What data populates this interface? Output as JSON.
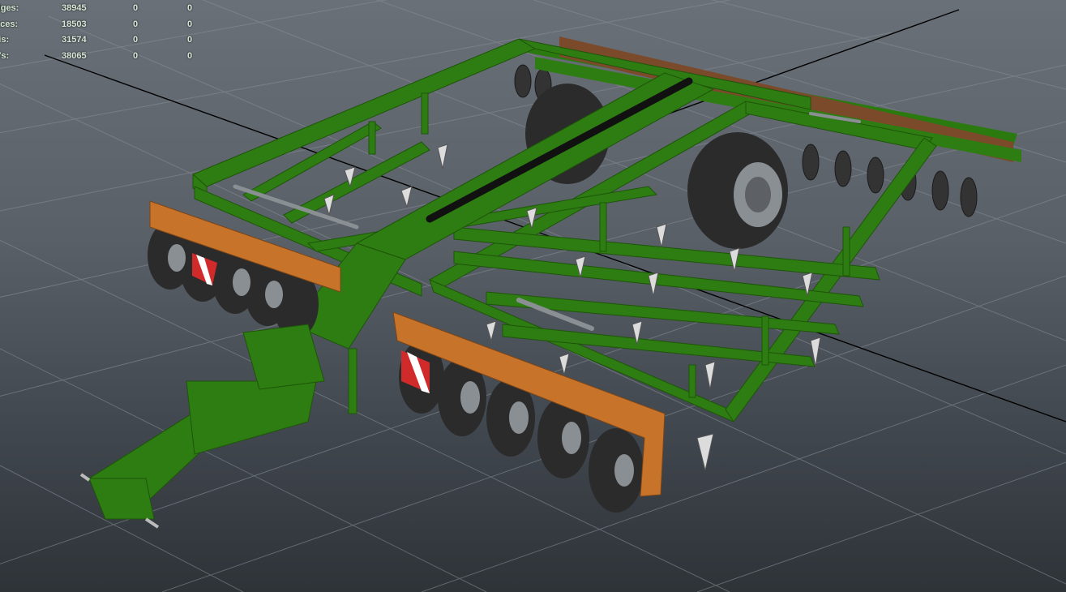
{
  "hud": {
    "rows": [
      {
        "label": "dges:",
        "value": "38945",
        "selected": "0",
        "components": "0"
      },
      {
        "label": "aces:",
        "value": "18503",
        "selected": "0",
        "components": "0"
      },
      {
        "label": "ris:",
        "value": "31574",
        "selected": "0",
        "components": "0"
      },
      {
        "label": "Vs:",
        "value": "38065",
        "selected": "0",
        "components": "0"
      }
    ]
  },
  "colors": {
    "frame_green": "#2e7d12",
    "frame_green_dark": "#1d5509",
    "orange_beam": "#c8732a",
    "tire": "#2b2b2b",
    "rim": "#8a8f94",
    "grid_line": "#9aa0a6",
    "axis_line": "#000000"
  }
}
